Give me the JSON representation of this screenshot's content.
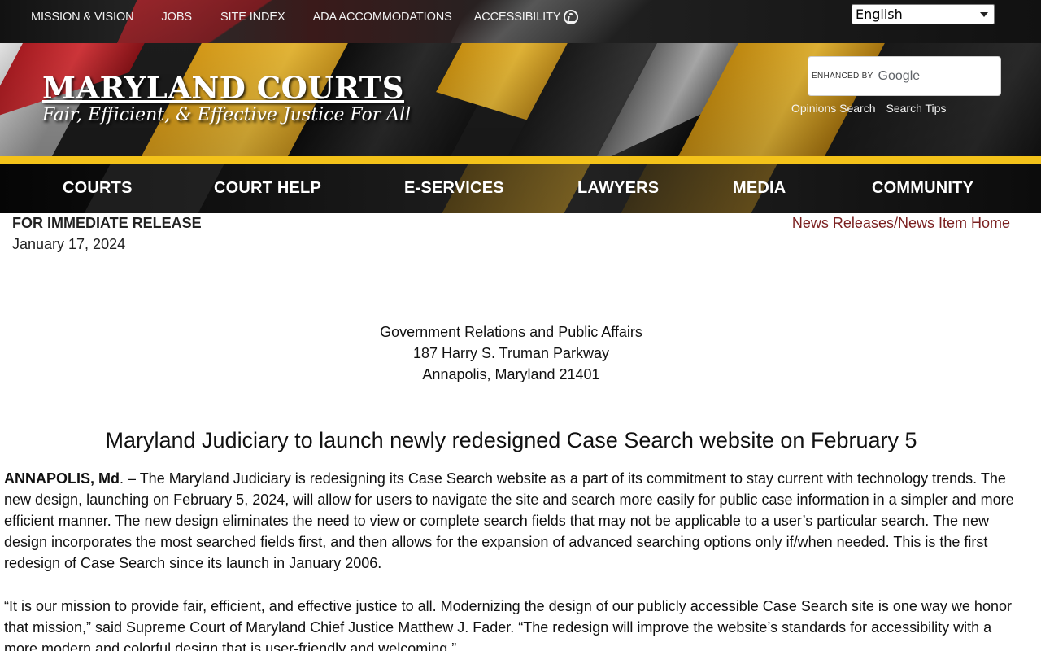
{
  "utility_nav": {
    "mission": "MISSION & VISION",
    "jobs": "JOBS",
    "site_index": "SITE INDEX",
    "ada": "ADA ACCOMMODATIONS",
    "accessibility": "ACCESSIBILITY"
  },
  "language": {
    "selected": "English"
  },
  "banner": {
    "title": "MARYLAND COURTS",
    "tagline": "Fair, Efficient, & Effective Justice For All"
  },
  "search": {
    "enhanced_by": "ENHANCED BY",
    "provider": "Google",
    "opinions_link": "Opinions Search",
    "tips_link": "Search Tips"
  },
  "main_nav": {
    "courts": "COURTS",
    "court_help": "COURT HELP",
    "eservices": "E-SERVICES",
    "lawyers": "LAWYERS",
    "media": "MEDIA",
    "community": "COMMUNITY"
  },
  "article": {
    "release_label": "FOR IMMEDIATE RELEASE",
    "date": "January 17, 2024",
    "home_link": "News Releases/News Item Home",
    "address": {
      "line1": "Government Relations and Public Affairs",
      "line2": "187 Harry S. Truman Parkway",
      "line3": "Annapolis, Maryland 21401"
    },
    "headline": "Maryland Judiciary to launch newly redesigned Case Search website on February 5",
    "dateline": "ANNAPOLIS, Md",
    "para1_rest": ". – The Maryland Judiciary is redesigning its Case Search website as a part of its commitment to stay current with technology trends. The new design, launching on February 5, 2024, will allow for users to navigate the site and search more easily for public case information in a simpler and more efficient manner. The new design eliminates the need to view or complete search fields that may not be applicable to a user’s particular search. The new design incorporates the most searched fields first, and then allows for the expansion of advanced searching options only if/when needed. This is the first redesign of Case Search since its launch in January 2006.",
    "para2": "“It is our mission to provide fair, efficient, and effective justice to all. Modernizing the design of our publicly accessible Case Search site is one way we honor that mission,” said Supreme Court of Maryland Chief Justice Matthew J. Fader. “The redesign will improve the website’s standards for accessibility with a more modern and colorful design that is user-friendly and welcoming.”"
  },
  "colors": {
    "flag_gold": "#f3c21a",
    "flag_red": "#c8282f",
    "link_maroon": "#7a1f1f",
    "nav_black": "#111111"
  },
  "icons": {
    "accessibility": "accessibility-icon",
    "dropdown": "chevron-down-icon"
  }
}
